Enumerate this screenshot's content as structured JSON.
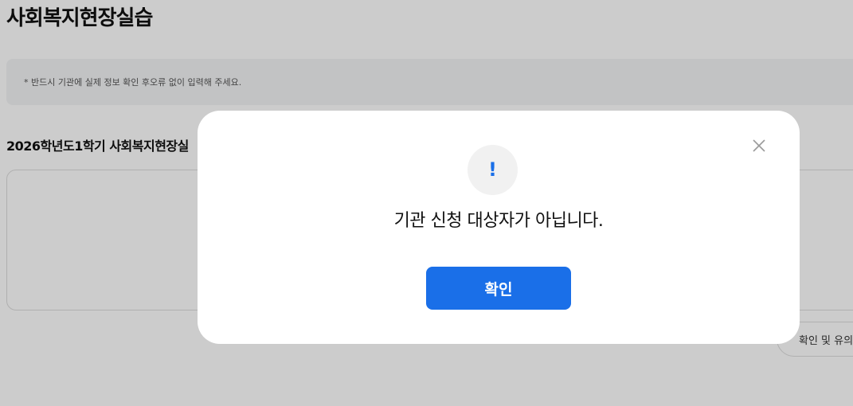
{
  "page": {
    "title": "사회복지현장실습",
    "notice": "* 반드시 기관에 실제 정보 확인 후오류 없이 입력해 주세요.",
    "section_title": "2026학년도1학기 사회복지현장실",
    "guide_button_label": "확인 및 유의"
  },
  "modal": {
    "icon": "exclamation-icon",
    "icon_glyph": "!",
    "message": "기관 신청 대상자가 아닙니다.",
    "confirm_label": "확인",
    "close_icon": "close-icon"
  },
  "colors": {
    "accent": "#1a6fe8",
    "overlay": "rgba(0,0,0,0.2)",
    "icon_background": "#f1f1f1"
  }
}
